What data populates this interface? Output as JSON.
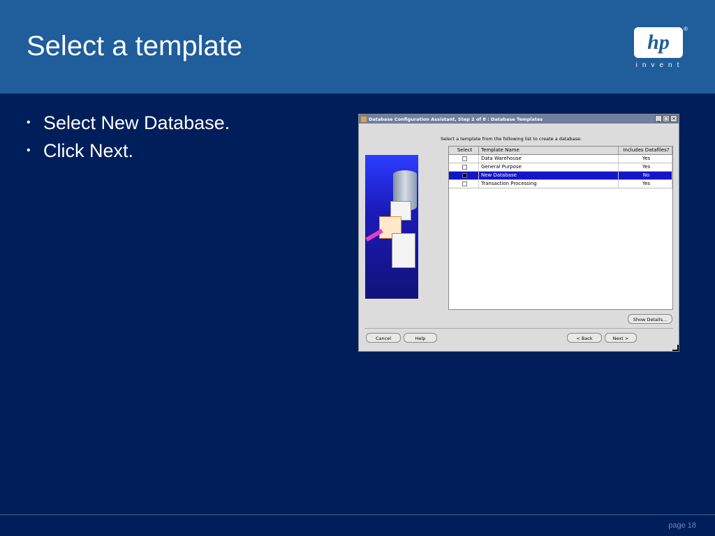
{
  "slide": {
    "title": "Select a template",
    "bullets": [
      "Select New Database.",
      "Click Next."
    ],
    "page": "page 18"
  },
  "logo": {
    "mark": "hp",
    "tagline": "invent",
    "reg": "®"
  },
  "dialog": {
    "title": "Database Configuration Assistant, Step 2 of 8 : Database Templates",
    "window_buttons": [
      "_",
      "□",
      "×"
    ],
    "instruction": "Select a template from the following list to create a database:",
    "columns": [
      "Select",
      "Template Name",
      "Includes Datafiles?"
    ],
    "rows": [
      {
        "name": "Data Warehouse",
        "datafiles": "Yes",
        "selected": false
      },
      {
        "name": "General Purpose",
        "datafiles": "Yes",
        "selected": false
      },
      {
        "name": "New Database",
        "datafiles": "No",
        "selected": true
      },
      {
        "name": "Transaction Processing",
        "datafiles": "Yes",
        "selected": false
      }
    ],
    "show_details": "Show Details...",
    "cancel": "Cancel",
    "help": "Help",
    "back": "< Back",
    "next": "Next >"
  },
  "colors": {
    "background": "#001f5a",
    "header": "#1f5d9b",
    "selection": "#1414c8"
  }
}
